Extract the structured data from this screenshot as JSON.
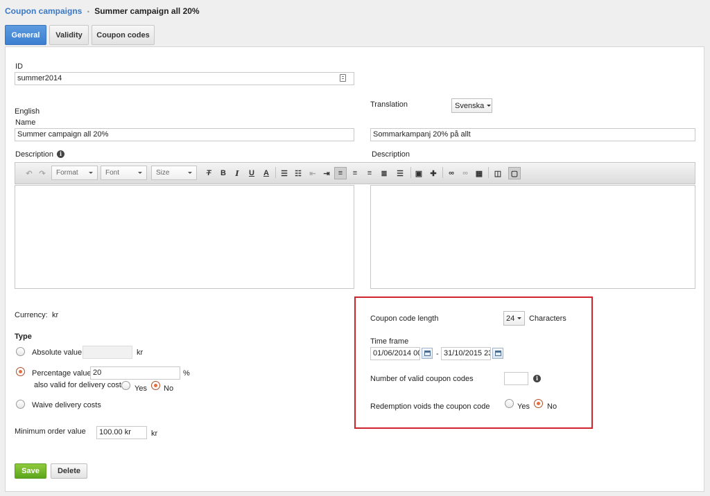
{
  "breadcrumb": {
    "parent": "Coupon campaigns",
    "separator": "•",
    "current": "Summer campaign all 20%"
  },
  "tabs": [
    {
      "label": "General",
      "active": true
    },
    {
      "label": "Validity",
      "active": false
    },
    {
      "label": "Coupon codes",
      "active": false
    }
  ],
  "form": {
    "id_label": "ID",
    "id_value": "summer2014",
    "language_label": "English",
    "name_label": "Name",
    "name_value": "Summer campaign all 20%",
    "translation_label": "Translation",
    "translation_value": "Svenska",
    "translated_name_value": "Sommarkampanj 20% på allt",
    "description_label": "Description",
    "translated_description_label": "Description"
  },
  "editor": {
    "format_label": "Format",
    "font_label": "Font",
    "size_label": "Size"
  },
  "pricing": {
    "currency_label": "Currency:",
    "currency_value": "kr",
    "type_heading": "Type",
    "absolute_label": "Absolute value",
    "absolute_unit": "kr",
    "percentage_label": "Percentage value",
    "percentage_value": "20",
    "percentage_unit": "%",
    "delivery_label": "also valid for delivery costs",
    "yes_label": "Yes",
    "no_label": "No",
    "waive_label": "Waive delivery costs",
    "min_order_label": "Minimum order value",
    "min_order_value": "100.00 kr",
    "min_order_unit": "kr",
    "selected_type": "percentage",
    "delivery_selected": "no"
  },
  "codes": {
    "length_label": "Coupon code length",
    "length_value": "24",
    "length_unit": "Characters",
    "timeframe_label": "Time frame",
    "start_value": "01/06/2014 00:",
    "range_separator": "-",
    "end_value": "31/10/2015 23",
    "valid_count_label": "Number of valid coupon codes",
    "valid_count_value": "",
    "redemption_label": "Redemption voids the coupon code",
    "yes_label": "Yes",
    "no_label": "No",
    "redemption_selected": "no"
  },
  "actions": {
    "save_label": "Save",
    "delete_label": "Delete"
  },
  "colors": {
    "accent": "#3b7fd0",
    "save": "#6bb226",
    "highlight_border": "#d0232b",
    "radio_selected": "#e2703f"
  }
}
